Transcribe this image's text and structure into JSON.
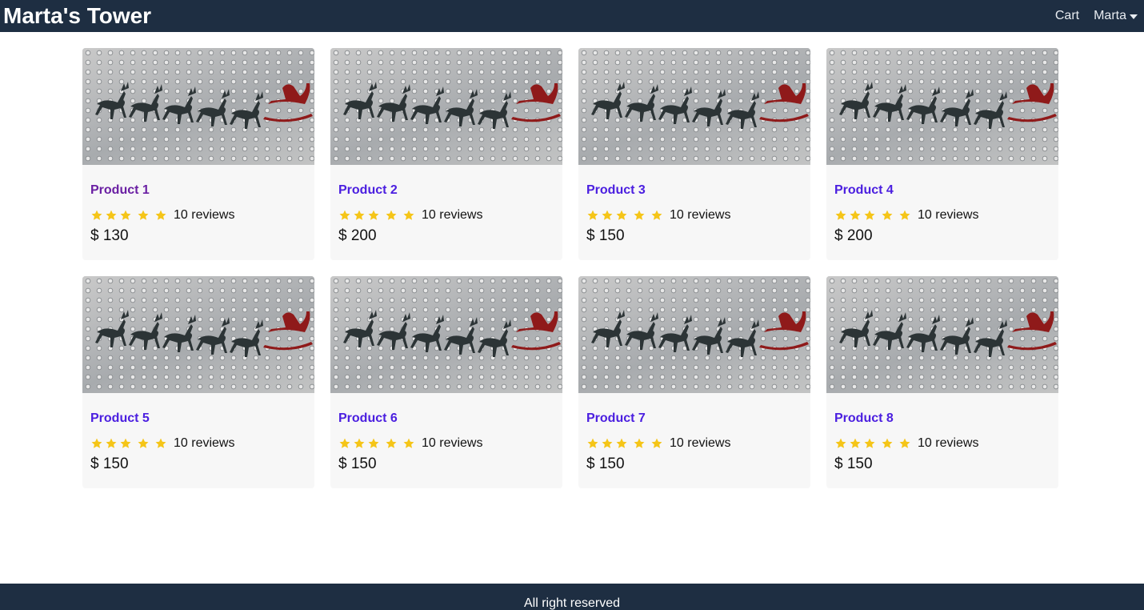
{
  "header": {
    "brand": "Marta's Tower",
    "cart_label": "Cart",
    "user_label": "Marta"
  },
  "products": [
    {
      "title": "Product 1",
      "reviews": "10 reviews",
      "price": "$ 130",
      "stars": 5
    },
    {
      "title": "Product 2",
      "reviews": "10 reviews",
      "price": "$ 200",
      "stars": 5
    },
    {
      "title": "Product 3",
      "reviews": "10 reviews",
      "price": "$ 150",
      "stars": 5
    },
    {
      "title": "Product 4",
      "reviews": "10 reviews",
      "price": "$ 200",
      "stars": 5
    },
    {
      "title": "Product 5",
      "reviews": "10 reviews",
      "price": "$ 150",
      "stars": 5
    },
    {
      "title": "Product 6",
      "reviews": "10 reviews",
      "price": "$ 150",
      "stars": 5
    },
    {
      "title": "Product 7",
      "reviews": "10 reviews",
      "price": "$ 150",
      "stars": 5
    },
    {
      "title": "Product 8",
      "reviews": "10 reviews",
      "price": "$ 150",
      "stars": 5
    }
  ],
  "footer": {
    "text": "All right reserved"
  },
  "colors": {
    "navbar": "#1e2e42",
    "link": "#4b1fe0",
    "visited_link": "#6a1fa3",
    "star": "#f5c518",
    "card": "#f7f7f7"
  },
  "icons": {
    "star": "star-icon",
    "dropdown": "caret-down-icon"
  }
}
